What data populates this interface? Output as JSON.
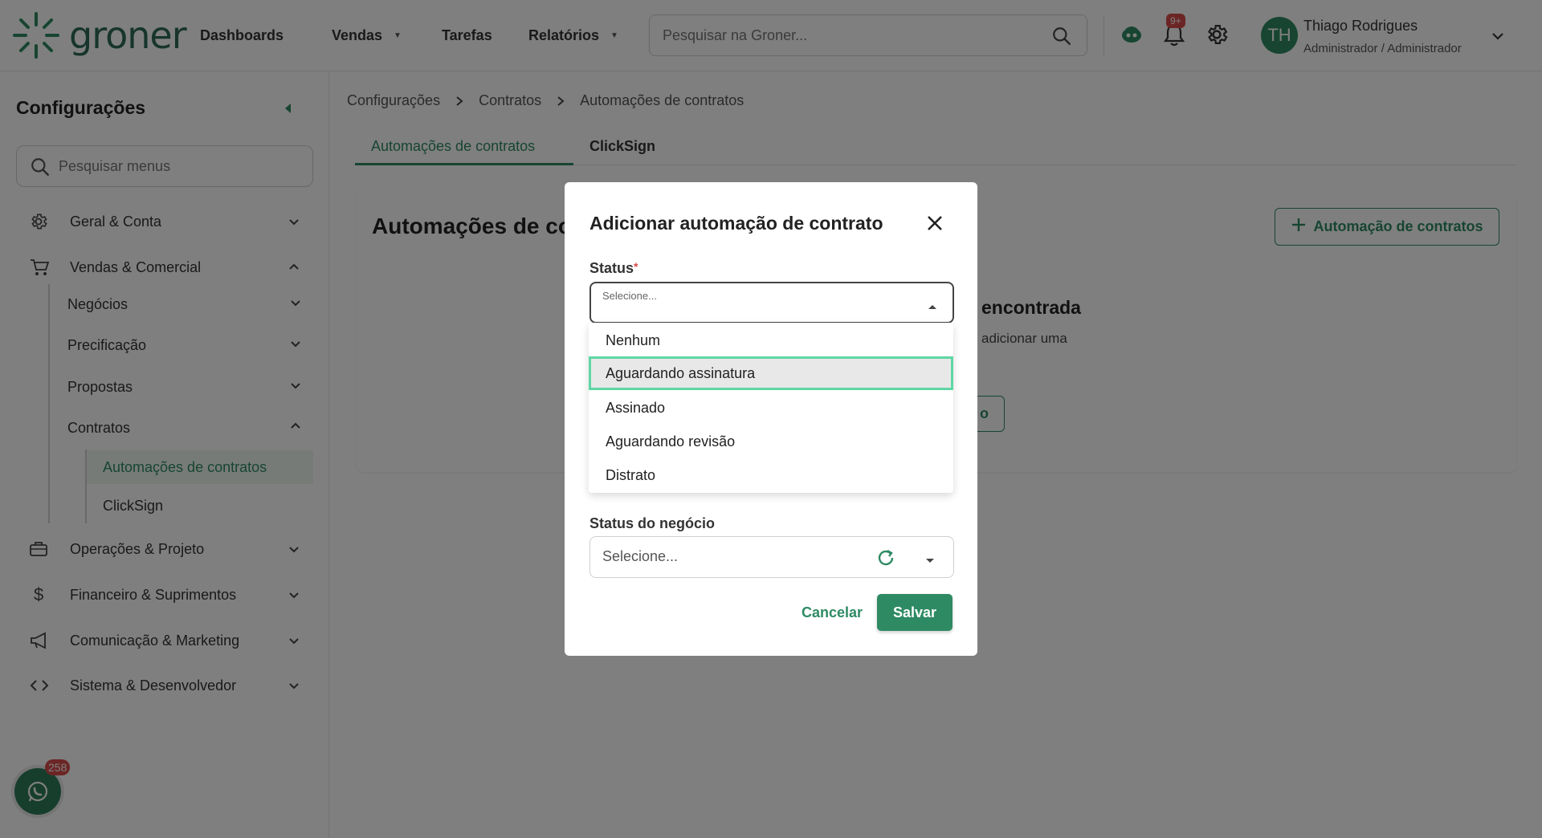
{
  "app": {
    "logo_text": "groner"
  },
  "topnav": {
    "items": [
      {
        "label": "Dashboards",
        "has_caret": false
      },
      {
        "label": "Vendas",
        "has_caret": true
      },
      {
        "label": "Tarefas",
        "has_caret": false
      },
      {
        "label": "Relatórios",
        "has_caret": true
      }
    ],
    "search_placeholder": "Pesquisar na Groner...",
    "notification_badge": "9+",
    "user": {
      "initials": "TH",
      "name": "Thiago Rodrigues",
      "role": "Administrador / Administrador"
    }
  },
  "colors": {
    "brand": "#2e8a63",
    "badge": "#d84a4a",
    "overlay": "rgba(0,0,0,0.5)"
  },
  "sidebar": {
    "title": "Configurações",
    "search_placeholder": "Pesquisar menus",
    "groups": [
      {
        "label": "Geral & Conta",
        "icon": "gear-icon"
      },
      {
        "label": "Vendas & Comercial",
        "icon": "cart-icon"
      },
      {
        "label": "Operações & Projeto",
        "icon": "briefcase-icon"
      },
      {
        "label": "Financeiro & Suprimentos",
        "icon": "dollar-icon"
      },
      {
        "label": "Comunicação & Marketing",
        "icon": "megaphone-icon"
      },
      {
        "label": "Sistema & Desenvolvedor",
        "icon": "code-icon"
      }
    ],
    "vendas_children": [
      "Negócios",
      "Precificação",
      "Propostas",
      "Contratos"
    ],
    "contratos_children": [
      "Automações de contratos",
      "ClickSign"
    ],
    "whatsapp_badge": "258"
  },
  "main": {
    "breadcrumb": [
      "Configurações",
      "Contratos",
      "Automações de contratos"
    ],
    "tabs": [
      "Automações de contratos",
      "ClickSign"
    ],
    "card_title": "Automações de co",
    "add_button_label": "Automação de contratos",
    "empty_title": "encontrada",
    "empty_desc": "adicionar uma",
    "empty_button_label": "o"
  },
  "modal": {
    "title": "Adicionar automação de contrato",
    "status_label": "Status",
    "status_required_mark": "*",
    "status_placeholder": "Selecione...",
    "status_options": [
      "Nenhum",
      "Aguardando assinatura",
      "Assinado",
      "Aguardando revisão",
      "Distrato"
    ],
    "status_highlighted": "Aguardando assinatura",
    "business_status_label": "Status do negócio",
    "business_status_placeholder": "Selecione...",
    "cancel_label": "Cancelar",
    "save_label": "Salvar"
  }
}
